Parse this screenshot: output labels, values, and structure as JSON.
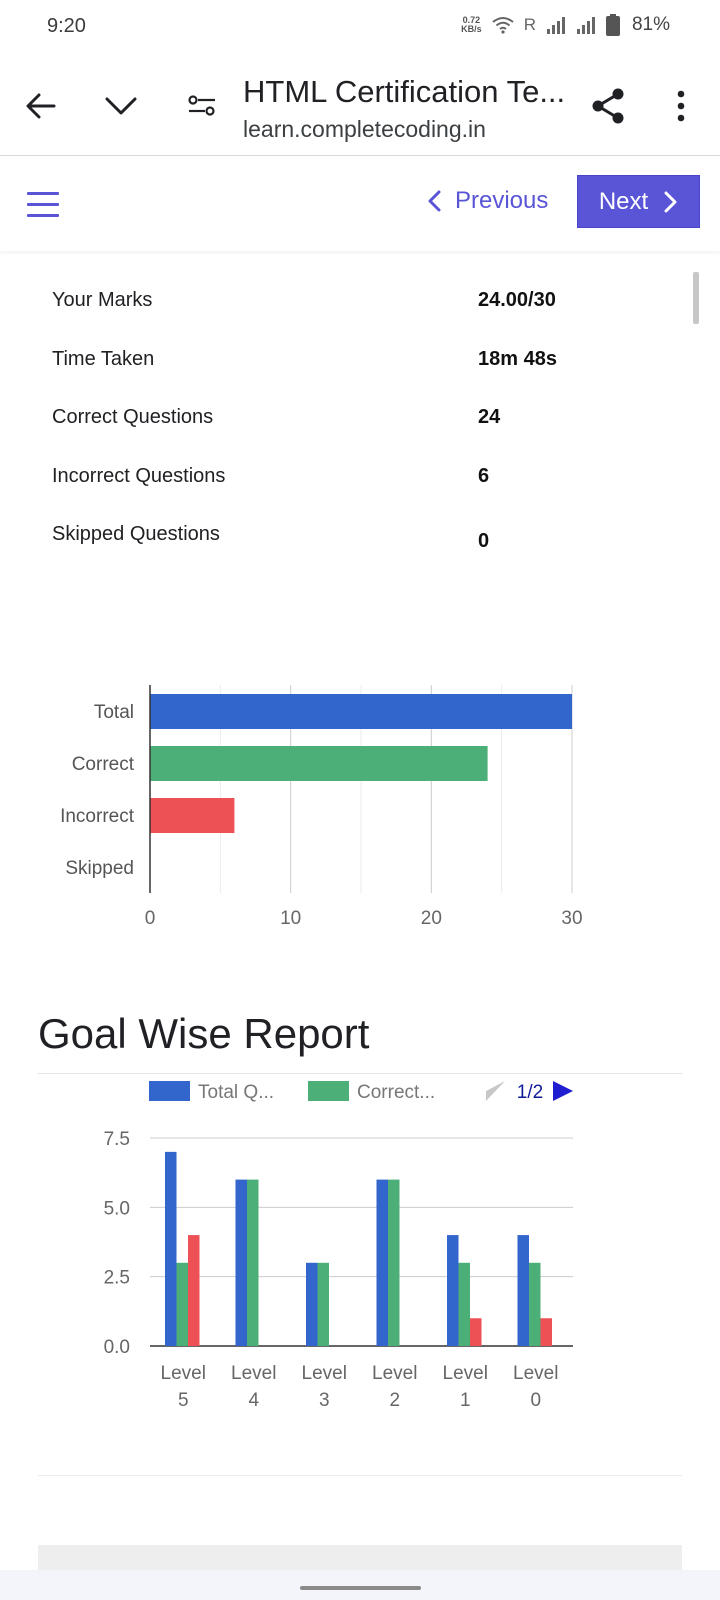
{
  "status_bar": {
    "time": "9:20",
    "net_speed_value": "0.72",
    "net_speed_unit": "KB/s",
    "roaming": "R",
    "battery": "81%"
  },
  "browser": {
    "title": "HTML Certification Te...",
    "url": "learn.completecoding.in"
  },
  "nav": {
    "previous_label": "Previous",
    "next_label": "Next"
  },
  "stats": [
    {
      "label": "Your Marks",
      "value": "24.00/30"
    },
    {
      "label": "Time Taken",
      "value": "18m 48s"
    },
    {
      "label": "Correct Questions",
      "value": "24"
    },
    {
      "label": "Incorrect Questions",
      "value": "6"
    },
    {
      "label": "Skipped Questions",
      "value": "0"
    }
  ],
  "section_title": "Goal Wise Report",
  "colors": {
    "accent": "#5a55d6",
    "blue": "#3366cc",
    "green": "#4caf78",
    "red": "#ed5055"
  },
  "chart_data": [
    {
      "type": "bar",
      "orientation": "horizontal",
      "categories": [
        "Total",
        "Correct",
        "Incorrect",
        "Skipped"
      ],
      "values": [
        30,
        24,
        6,
        0
      ],
      "colors": [
        "#3366cc",
        "#4caf78",
        "#ed5055",
        "#999999"
      ],
      "xlim": [
        0,
        30
      ],
      "xticks": [
        "0",
        "10",
        "20",
        "30"
      ],
      "grid": true
    },
    {
      "type": "bar",
      "categories": [
        "Level 5",
        "Level 4",
        "Level 3",
        "Level 2",
        "Level 1",
        "Level 0"
      ],
      "category_lines": [
        [
          "Level",
          "5"
        ],
        [
          "Level",
          "4"
        ],
        [
          "Level",
          "3"
        ],
        [
          "Level",
          "2"
        ],
        [
          "Level",
          "1"
        ],
        [
          "Level",
          "0"
        ]
      ],
      "series": [
        {
          "name": "Total Q...",
          "color": "#3366cc",
          "values": [
            7,
            6,
            3,
            6,
            4,
            4
          ]
        },
        {
          "name": "Correct...",
          "color": "#4caf78",
          "values": [
            3,
            6,
            3,
            6,
            3,
            3
          ]
        },
        {
          "color": "#ed5055",
          "values": [
            4,
            0,
            0,
            0,
            1,
            1
          ]
        }
      ],
      "ylim": [
        0,
        7.5
      ],
      "yticks": [
        "7.5",
        "5.0",
        "2.5",
        "0.0"
      ],
      "legend_page": "1/2",
      "legend_position": "top",
      "grid": true
    }
  ]
}
